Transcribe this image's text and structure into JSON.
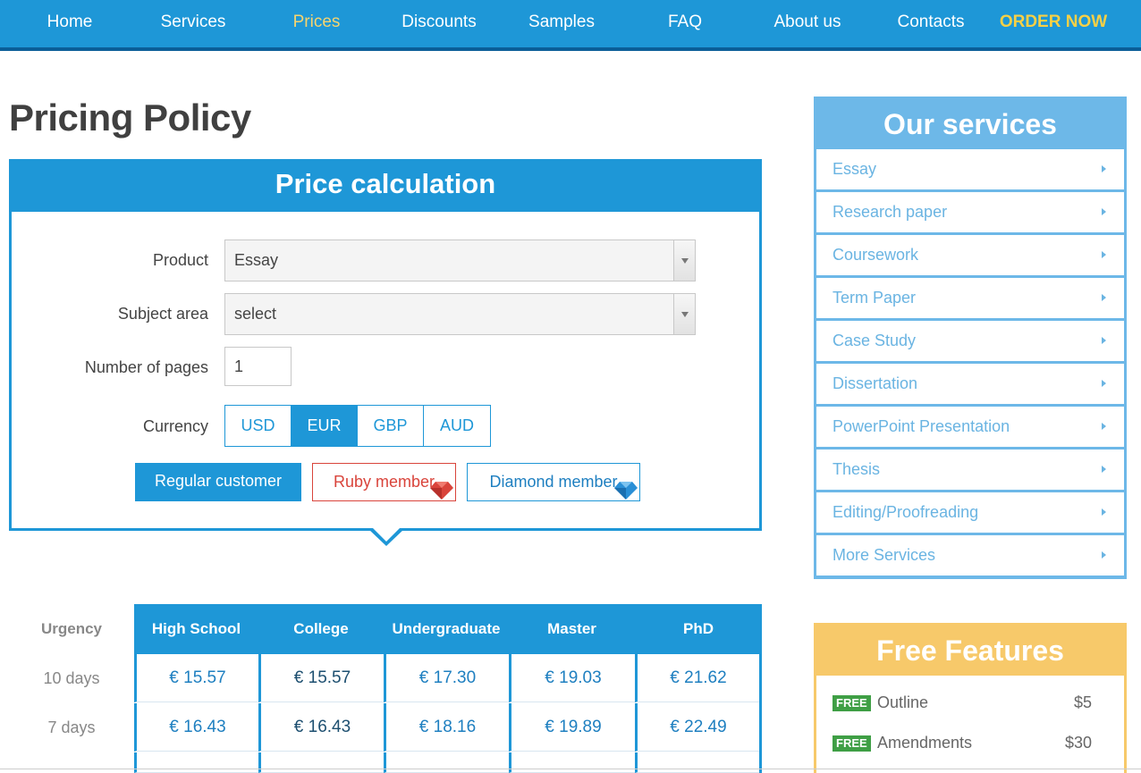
{
  "nav": {
    "items": [
      "Home",
      "Services",
      "Prices",
      "Discounts",
      "Samples",
      "FAQ",
      "About us",
      "Contacts",
      "ORDER NOW"
    ],
    "active": "Prices"
  },
  "page_title": "Pricing Policy",
  "calc": {
    "title": "Price calculation",
    "product_label": "Product",
    "product_value": "Essay",
    "subject_label": "Subject area",
    "subject_value": "select",
    "pages_label": "Number of pages",
    "pages_value": "1",
    "currency_label": "Currency",
    "currencies": [
      "USD",
      "EUR",
      "GBP",
      "AUD"
    ],
    "currency_selected": "EUR",
    "tiers": [
      "Regular customer",
      "Ruby member",
      "Diamond member"
    ]
  },
  "table": {
    "urgency_label": "Urgency",
    "levels": [
      "High School",
      "College",
      "Undergraduate",
      "Master",
      "PhD"
    ],
    "rows": [
      {
        "urgency": "10 days",
        "prices": [
          "€ 15.57",
          "€ 15.57",
          "€ 17.30",
          "€ 19.03",
          "€ 21.62"
        ]
      },
      {
        "urgency": "7 days",
        "prices": [
          "€ 16.43",
          "€ 16.43",
          "€ 18.16",
          "€ 19.89",
          "€ 22.49"
        ]
      }
    ]
  },
  "services": {
    "title": "Our services",
    "items": [
      "Essay",
      "Research paper",
      "Coursework",
      "Term Paper",
      "Case Study",
      "Dissertation",
      "PowerPoint Presentation",
      "Thesis",
      "Editing/Proofreading",
      "More Services"
    ]
  },
  "free_features": {
    "title": "Free Features",
    "badge": "FREE",
    "items": [
      {
        "name": "Outline",
        "price": "$5"
      },
      {
        "name": "Amendments",
        "price": "$30"
      }
    ]
  },
  "colors": {
    "primary": "#1e97d7",
    "nav_active": "#f7d46e",
    "order_now": "#f7d046",
    "sidebar": "#6db8e8",
    "features": "#f7c96a",
    "ruby": "#d9443b",
    "free_badge": "#3f9f45"
  }
}
